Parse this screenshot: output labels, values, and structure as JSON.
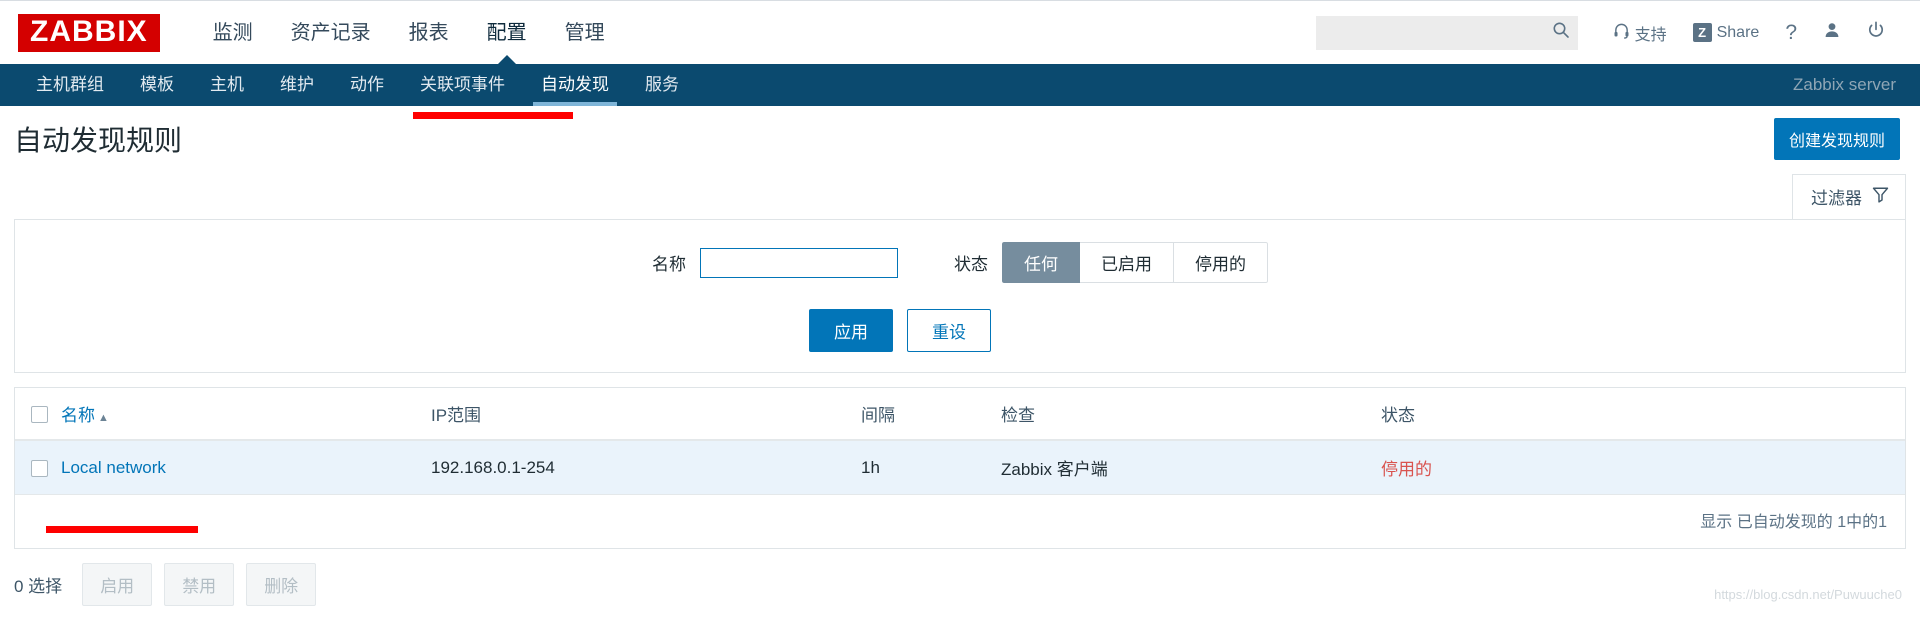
{
  "topbar": {
    "logo": "ZABBIX",
    "nav": [
      {
        "label": "监测",
        "active": false
      },
      {
        "label": "资产记录",
        "active": false
      },
      {
        "label": "报表",
        "active": false
      },
      {
        "label": "配置",
        "active": true
      },
      {
        "label": "管理",
        "active": false
      }
    ],
    "search": {
      "value": "",
      "placeholder": ""
    },
    "support_label": "支持",
    "share_label": "Share",
    "share_badge": "Z",
    "help_label": "?",
    "icons": {
      "search": "search-icon",
      "support": "headset-icon",
      "share": "share-z-icon",
      "help": "question-mark-icon",
      "user": "person-icon",
      "logout": "power-icon"
    }
  },
  "subnav": {
    "items": [
      {
        "label": "主机群组",
        "active": false
      },
      {
        "label": "模板",
        "active": false
      },
      {
        "label": "主机",
        "active": false
      },
      {
        "label": "维护",
        "active": false
      },
      {
        "label": "动作",
        "active": false
      },
      {
        "label": "关联项事件",
        "active": false
      },
      {
        "label": "自动发现",
        "active": true
      },
      {
        "label": "服务",
        "active": false
      }
    ],
    "server": "Zabbix server"
  },
  "page": {
    "title": "自动发现规则",
    "create_button": "创建发现规则"
  },
  "filter": {
    "tab_label": "过滤器",
    "name_label": "名称",
    "name_value": "",
    "name_placeholder": "",
    "status_label": "状态",
    "status_options": [
      {
        "label": "任何",
        "active": true
      },
      {
        "label": "已启用",
        "active": false
      },
      {
        "label": "停用的",
        "active": false
      }
    ],
    "apply_label": "应用",
    "reset_label": "重设"
  },
  "table": {
    "headers": {
      "name": "名称",
      "sort_arrow": "▲",
      "ip_range": "IP范围",
      "interval": "间隔",
      "checks": "检查",
      "status": "状态"
    },
    "rows": [
      {
        "name": "Local network",
        "ip_range": "192.168.0.1-254",
        "interval": "1h",
        "checks": "Zabbix 客户端",
        "status": "停用的"
      }
    ],
    "footer": "显示 已自动发现的 1中的1"
  },
  "actionbar": {
    "selected_count": "0 选择",
    "buttons": [
      {
        "label": "启用"
      },
      {
        "label": "禁用"
      },
      {
        "label": "删除"
      }
    ]
  },
  "watermark": "https://blog.csdn.net/Puwuuche0",
  "colors": {
    "brand_red": "#d40000",
    "nav_blue": "#0b4a6f",
    "accent_blue": "#0275b8",
    "active_underline": "#7fb5d8",
    "annotation_red": "#fe0000",
    "status_disabled": "#d9534f",
    "row_bg": "#eaf3fb"
  }
}
